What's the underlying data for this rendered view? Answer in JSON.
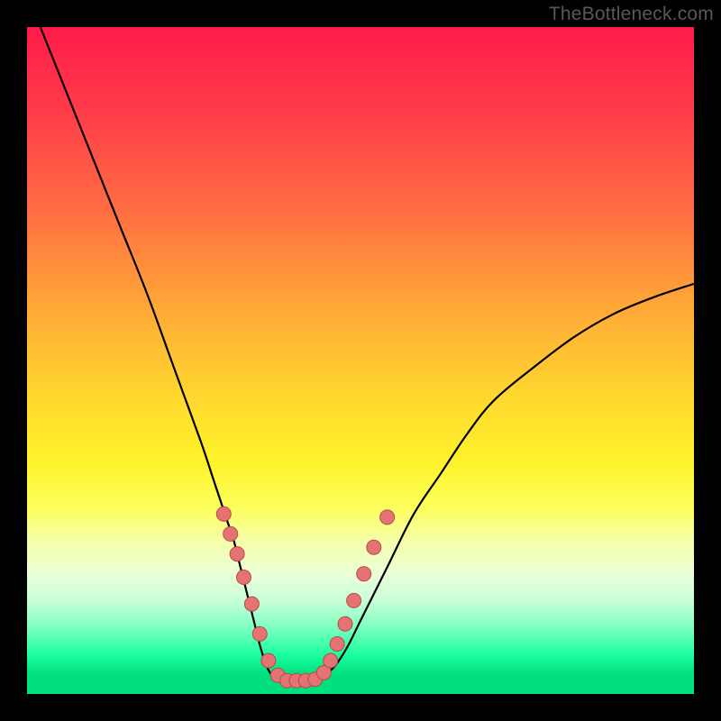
{
  "watermark": "TheBottleneck.com",
  "colors": {
    "frame": "#000000",
    "curve_stroke": "#000000",
    "dot_fill": "#e57373",
    "dot_stroke": "#b84a4a"
  },
  "chart_data": {
    "type": "line",
    "title": "",
    "xlabel": "",
    "ylabel": "",
    "xlim": [
      0,
      100
    ],
    "ylim": [
      0,
      100
    ],
    "grid": false,
    "series": [
      {
        "name": "bottleneck-curve",
        "x": [
          2,
          6,
          10,
          14,
          18,
          22,
          26,
          28,
          30,
          31,
          32,
          33,
          34,
          35,
          36,
          37,
          38,
          39,
          40,
          42,
          44,
          46,
          48,
          50,
          54,
          58,
          62,
          66,
          70,
          76,
          82,
          88,
          94,
          100
        ],
        "y": [
          100,
          90,
          80,
          70,
          60,
          49,
          38,
          32,
          26,
          23,
          19,
          15,
          11,
          7,
          4,
          2.5,
          2,
          2,
          2,
          2,
          2.5,
          4,
          7,
          11,
          19,
          27,
          33,
          39,
          44,
          49,
          53.5,
          57,
          59.5,
          61.5
        ]
      }
    ],
    "dots": {
      "name": "highlight-points",
      "x": [
        29.5,
        30.5,
        31.5,
        32.5,
        33.7,
        34.9,
        36.2,
        37.6,
        39.0,
        40.4,
        41.8,
        43.2,
        44.5,
        45.5,
        46.5,
        47.7,
        49.0,
        50.5,
        52.0,
        54.0
      ],
      "y": [
        27.0,
        24.0,
        21.0,
        17.5,
        13.5,
        9.0,
        5.0,
        2.8,
        2.0,
        2.0,
        2.0,
        2.2,
        3.2,
        5.0,
        7.5,
        10.5,
        14.0,
        18.0,
        22.0,
        26.5
      ]
    }
  }
}
